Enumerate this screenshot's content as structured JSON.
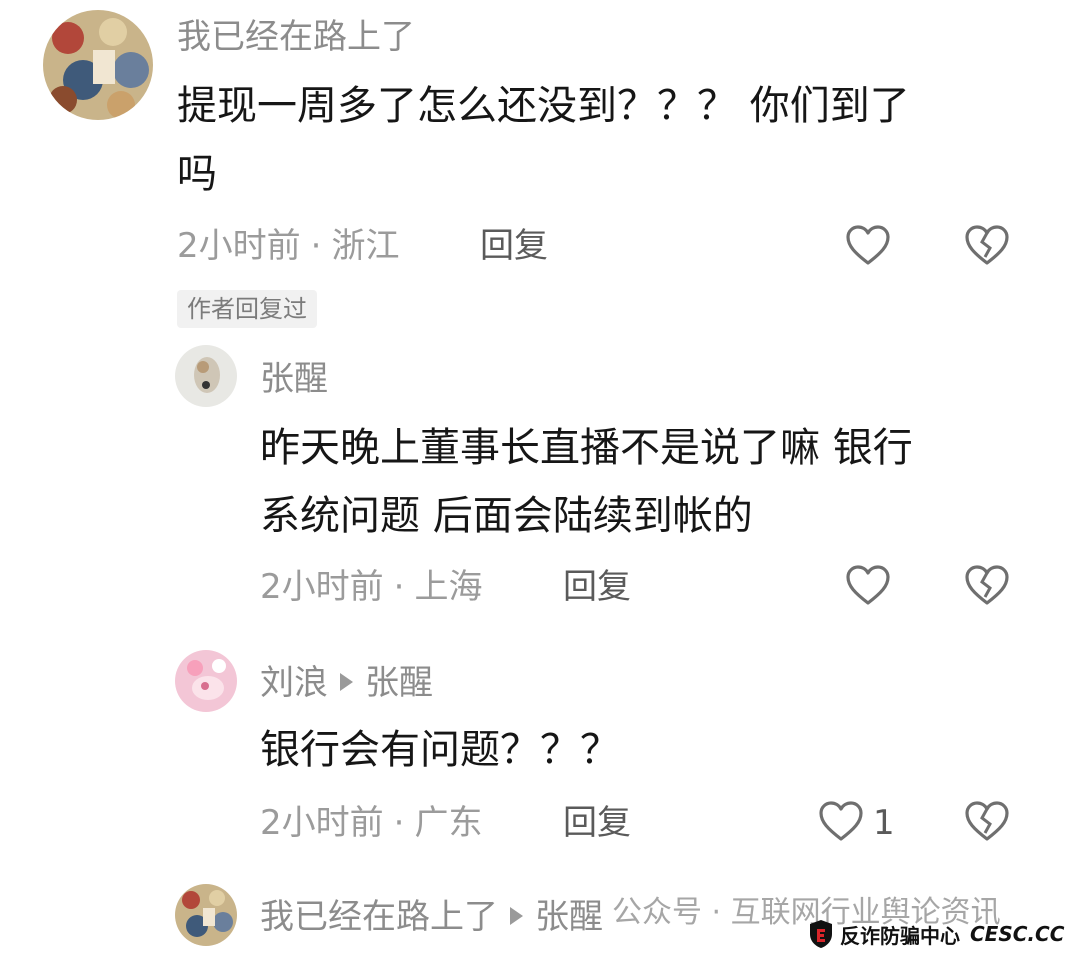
{
  "comments": [
    {
      "username": "我已经在路上了",
      "text_lines": [
        "提现一周多了怎么还没到？？？ 你们到了",
        "吗"
      ],
      "time": "2小时前",
      "location": "浙江",
      "reply_label": "回复",
      "like_icon": "heart-outline-icon",
      "dislike_icon": "broken-heart-icon",
      "badge": "作者回复过"
    },
    {
      "username": "张醒",
      "text_lines": [
        "昨天晚上董事长直播不是说了嘛 银行",
        "系统问题 后面会陆续到帐的"
      ],
      "time": "2小时前",
      "location": "上海",
      "reply_label": "回复"
    },
    {
      "username": "刘浪",
      "reply_to": "张醒",
      "text_lines": [
        "银行会有问题？？？"
      ],
      "time": "2小时前",
      "location": "广东",
      "reply_label": "回复",
      "like_count": "1"
    },
    {
      "username": "我已经在路上了",
      "reply_to": "张醒"
    }
  ],
  "meta_separator": "·",
  "watermark": {
    "line": "公众号 · 互联网行业舆论资讯"
  },
  "logo": {
    "cn": "反诈防骗中心",
    "en": "CESC.CC"
  },
  "colors": {
    "text": "#161616",
    "meta": "#9b9b9b",
    "username": "#8c8c8c",
    "icon": "#6f6f6f"
  }
}
